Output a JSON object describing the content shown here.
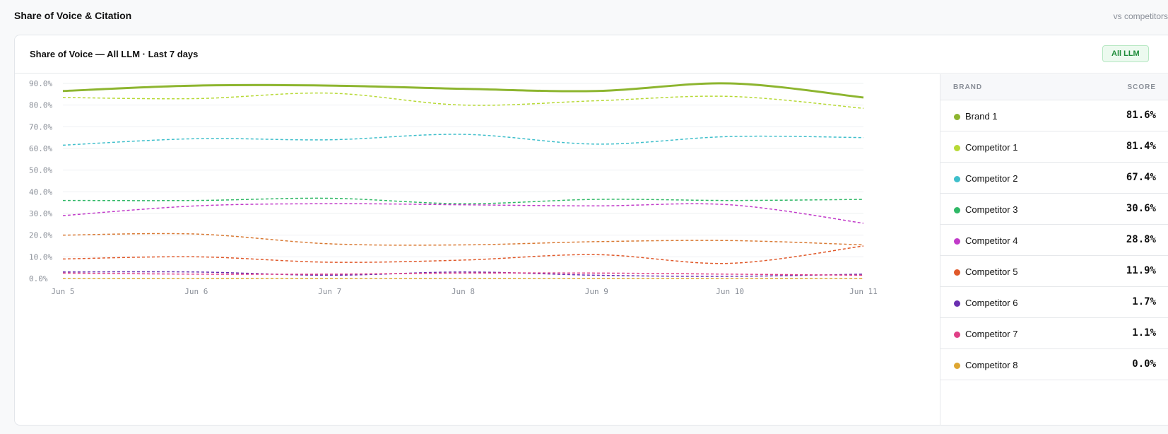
{
  "section": {
    "title": "Share of Voice & Citation",
    "aside": "vs competitors"
  },
  "card": {
    "title": "Share of Voice — All LLM · Last 7 days",
    "badge": "All LLM"
  },
  "table": {
    "headers": {
      "brand": "BRAND",
      "score": "SCORE"
    },
    "rows": [
      {
        "name": "Brand 1",
        "score": "81.6%",
        "color": "#8db52f"
      },
      {
        "name": "Competitor 1",
        "score": "81.4%",
        "color": "#b7d935"
      },
      {
        "name": "Competitor 2",
        "score": "67.4%",
        "color": "#3fbfcb"
      },
      {
        "name": "Competitor 3",
        "score": "30.6%",
        "color": "#2fb866"
      },
      {
        "name": "Competitor 4",
        "score": "28.8%",
        "color": "#c13ac9"
      },
      {
        "name": "Competitor 5",
        "score": "11.9%",
        "color": "#e0592a"
      },
      {
        "name": "Competitor 6",
        "score": "1.7%",
        "color": "#6a2fb0"
      },
      {
        "name": "Competitor 7",
        "score": "1.1%",
        "color": "#e03f86"
      },
      {
        "name": "Competitor 8",
        "score": "0.0%",
        "color": "#dea631"
      }
    ]
  },
  "chart_data": {
    "type": "line",
    "x": [
      "Jun 5",
      "Jun 6",
      "Jun 7",
      "Jun 8",
      "Jun 9",
      "Jun 10",
      "Jun 11"
    ],
    "yticks": [
      "0.0%",
      "10.0%",
      "20.0%",
      "30.0%",
      "40.0%",
      "50.0%",
      "60.0%",
      "70.0%",
      "80.0%",
      "90.0%"
    ],
    "ylim": [
      0,
      90
    ],
    "grid": true,
    "series": [
      {
        "name": "Brand 1",
        "color": "#8db52f",
        "dashed": false,
        "values": [
          86.5,
          89.0,
          89.0,
          87.5,
          86.5,
          90.0,
          83.5
        ]
      },
      {
        "name": "Competitor 1",
        "color": "#b7d935",
        "dashed": true,
        "values": [
          83.5,
          83.0,
          85.5,
          80.0,
          82.0,
          84.0,
          78.5
        ]
      },
      {
        "name": "Competitor 2",
        "color": "#3fbfcb",
        "dashed": true,
        "values": [
          61.5,
          64.5,
          64.0,
          66.5,
          62.0,
          65.5,
          65.0
        ]
      },
      {
        "name": "Competitor 3",
        "color": "#2fb866",
        "dashed": true,
        "values": [
          36.0,
          36.0,
          37.0,
          34.5,
          36.5,
          36.0,
          36.5
        ]
      },
      {
        "name": "Competitor 4",
        "color": "#c13ac9",
        "dashed": true,
        "values": [
          29.0,
          33.5,
          34.5,
          34.0,
          33.5,
          34.0,
          25.5
        ]
      },
      {
        "name": "Competitor 5",
        "color": "#e0592a",
        "dashed": true,
        "values": [
          9.0,
          10.0,
          7.5,
          8.5,
          11.0,
          7.0,
          15.0
        ]
      },
      {
        "name": "Competitor 6",
        "color": "#6a2fb0",
        "dashed": true,
        "values": [
          3.0,
          3.0,
          1.5,
          3.0,
          1.5,
          1.0,
          2.0
        ]
      },
      {
        "name": "Competitor 7",
        "color": "#e03f86",
        "dashed": true,
        "values": [
          2.5,
          2.0,
          2.0,
          2.5,
          2.5,
          2.0,
          1.5
        ]
      },
      {
        "name": "Competitor 8",
        "color": "#dea631",
        "dashed": true,
        "values": [
          0.0,
          0.0,
          0.0,
          0.0,
          0.0,
          0.0,
          0.0
        ]
      },
      {
        "name": "Competitor 5 (trend)",
        "color": "#d97a34",
        "dashed": true,
        "values": [
          20.0,
          20.5,
          16.0,
          15.5,
          17.0,
          17.5,
          15.5
        ]
      }
    ]
  }
}
